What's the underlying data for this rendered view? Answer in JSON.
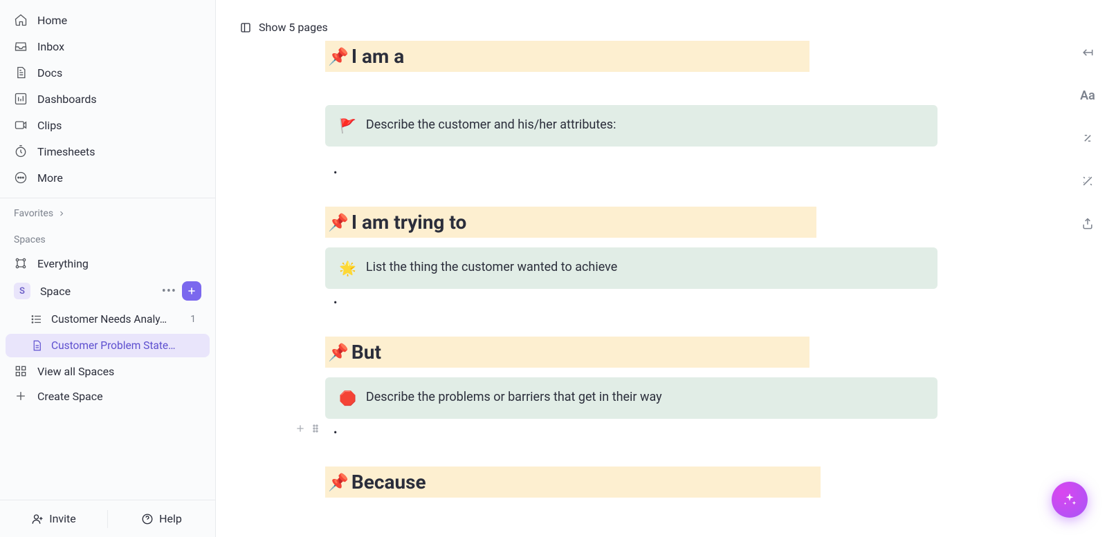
{
  "sidebar": {
    "nav": [
      {
        "label": "Home"
      },
      {
        "label": "Inbox"
      },
      {
        "label": "Docs"
      },
      {
        "label": "Dashboards"
      },
      {
        "label": "Clips"
      },
      {
        "label": "Timesheets"
      },
      {
        "label": "More"
      }
    ],
    "favorites_label": "Favorites",
    "spaces_label": "Spaces",
    "everything_label": "Everything",
    "space_name": "Space",
    "space_badge": "S",
    "tree": {
      "item1": "Customer Needs Analy…",
      "item1_count": "1",
      "item2": "Customer Problem State…"
    },
    "view_all": "View all Spaces",
    "create_space": "Create Space",
    "invite": "Invite",
    "help": "Help"
  },
  "doc": {
    "show_pages": "Show 5 pages",
    "sections": [
      {
        "heading": "I am a",
        "callout_icon": "🚩",
        "callout_text": "Describe the customer and his/her attributes:"
      },
      {
        "heading": "I am trying to",
        "callout_icon": "🌟",
        "callout_text": "List the thing the customer wanted to achieve"
      },
      {
        "heading": "But",
        "callout_icon": "🛑",
        "callout_text": "Describe the problems or barriers that get in their way"
      },
      {
        "heading": "Because"
      }
    ]
  }
}
